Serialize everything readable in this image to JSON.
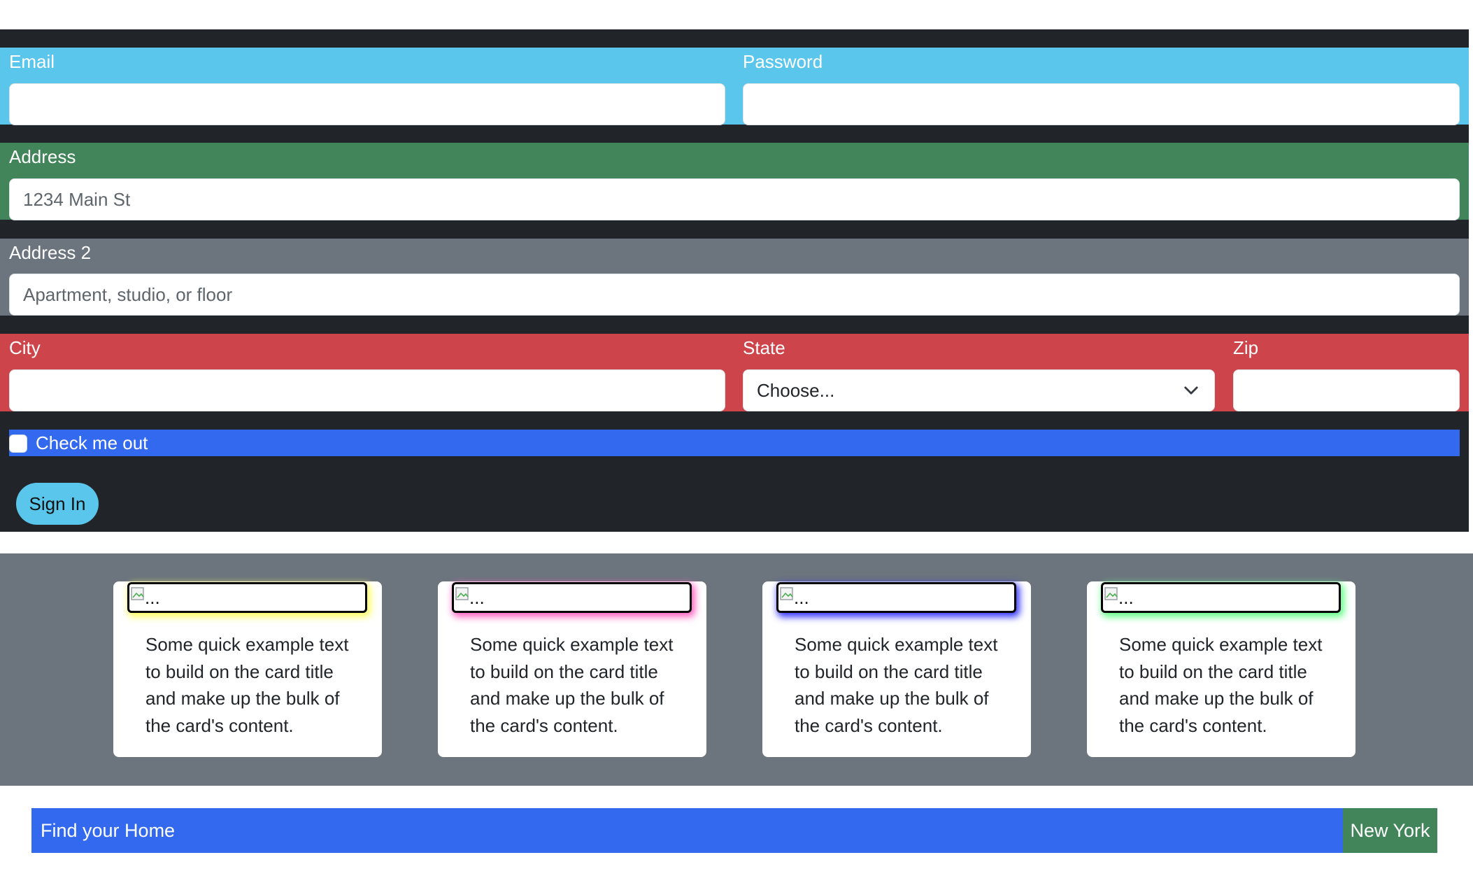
{
  "form": {
    "email_label": "Email",
    "email_value": "",
    "password_label": "Password",
    "password_value": "",
    "address_label": "Address",
    "address_placeholder": "1234 Main St",
    "address2_label": "Address 2",
    "address2_placeholder": "Apartment, studio, or floor",
    "city_label": "City",
    "city_value": "",
    "state_label": "State",
    "state_selected": "Choose...",
    "zip_label": "Zip",
    "zip_value": "",
    "checkbox_label": "Check me out",
    "checkbox_checked": false,
    "submit_label": "Sign In"
  },
  "cards": [
    {
      "image_alt": "...",
      "glow_color": "#ffff66",
      "text": "Some quick example text to build on the card title and make up the bulk of the card's content."
    },
    {
      "image_alt": "...",
      "glow_color": "#ff66c4",
      "text": "Some quick example text to build on the card title and make up the bulk of the card's content."
    },
    {
      "image_alt": "...",
      "glow_color": "#3b3bff",
      "text": "Some quick example text to build on the card title and make up the bulk of the card's content."
    },
    {
      "image_alt": "...",
      "glow_color": "#66ff88",
      "text": "Some quick example text to build on the card title and make up the bulk of the card's content."
    }
  ],
  "footer": {
    "title": "Find your Home",
    "city": "New York"
  },
  "colors": {
    "dark": "#212529",
    "info": "#5bc6ec",
    "success": "#42855a",
    "secondary": "#6c747e",
    "danger": "#cd444b",
    "primary": "#3369ef"
  },
  "icons": {
    "select": "chevron-down-icon",
    "card_image": "broken-image-icon"
  }
}
